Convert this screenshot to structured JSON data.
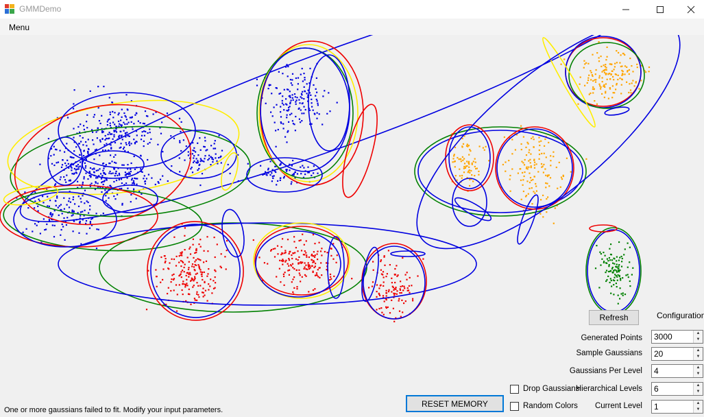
{
  "window": {
    "title": "GMMDemo"
  },
  "menu": {
    "label": "Menu"
  },
  "config": {
    "heading": "Configuration",
    "refresh_label": "Refresh",
    "generated_points": {
      "label": "Generated Points",
      "value": "3000"
    },
    "sample_gaussians": {
      "label": "Sample Gaussians",
      "value": "20"
    },
    "gaussians_per_level": {
      "label": "Gaussians Per Level",
      "value": "4"
    },
    "hierarchical_levels": {
      "label": "Hierarchical Levels",
      "value": "6"
    },
    "current_level": {
      "label": "Current Level",
      "value": "1"
    },
    "drop_gaussians": {
      "label": "Drop Gaussians",
      "checked": false
    },
    "random_colors": {
      "label": "Random Colors",
      "checked": false
    }
  },
  "reset_label": "RESET MEMORY",
  "status": "One or more gaussians failed to fit. Modify your input parameters.",
  "colors": {
    "cluster_blue": "#0000e0",
    "cluster_red": "#ee0000",
    "cluster_orange": "#ffa500",
    "cluster_green": "#008000",
    "ellipse_yellow": "#ffee00"
  }
}
